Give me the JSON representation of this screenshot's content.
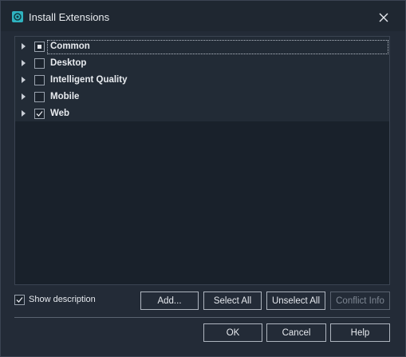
{
  "window": {
    "title": "Install Extensions",
    "app_icon": "extension-app-icon",
    "close_icon": "close-icon"
  },
  "tree": {
    "items": [
      {
        "label": "Common",
        "state": "partial",
        "expanded": false
      },
      {
        "label": "Desktop",
        "state": "unchecked",
        "expanded": false
      },
      {
        "label": "Intelligent Quality",
        "state": "unchecked",
        "expanded": false
      },
      {
        "label": "Mobile",
        "state": "unchecked",
        "expanded": false
      },
      {
        "label": "Web",
        "state": "checked",
        "expanded": false
      }
    ]
  },
  "options": {
    "show_description_label": "Show description",
    "show_description_checked": true
  },
  "buttons": {
    "add": "Add...",
    "select_all": "Select All",
    "unselect_all": "Unselect All",
    "conflict_info": "Conflict Info",
    "ok": "OK",
    "cancel": "Cancel",
    "help": "Help"
  },
  "colors": {
    "accent": "#2fb3c0",
    "background": "#232b37",
    "tree_background": "#19212b"
  }
}
